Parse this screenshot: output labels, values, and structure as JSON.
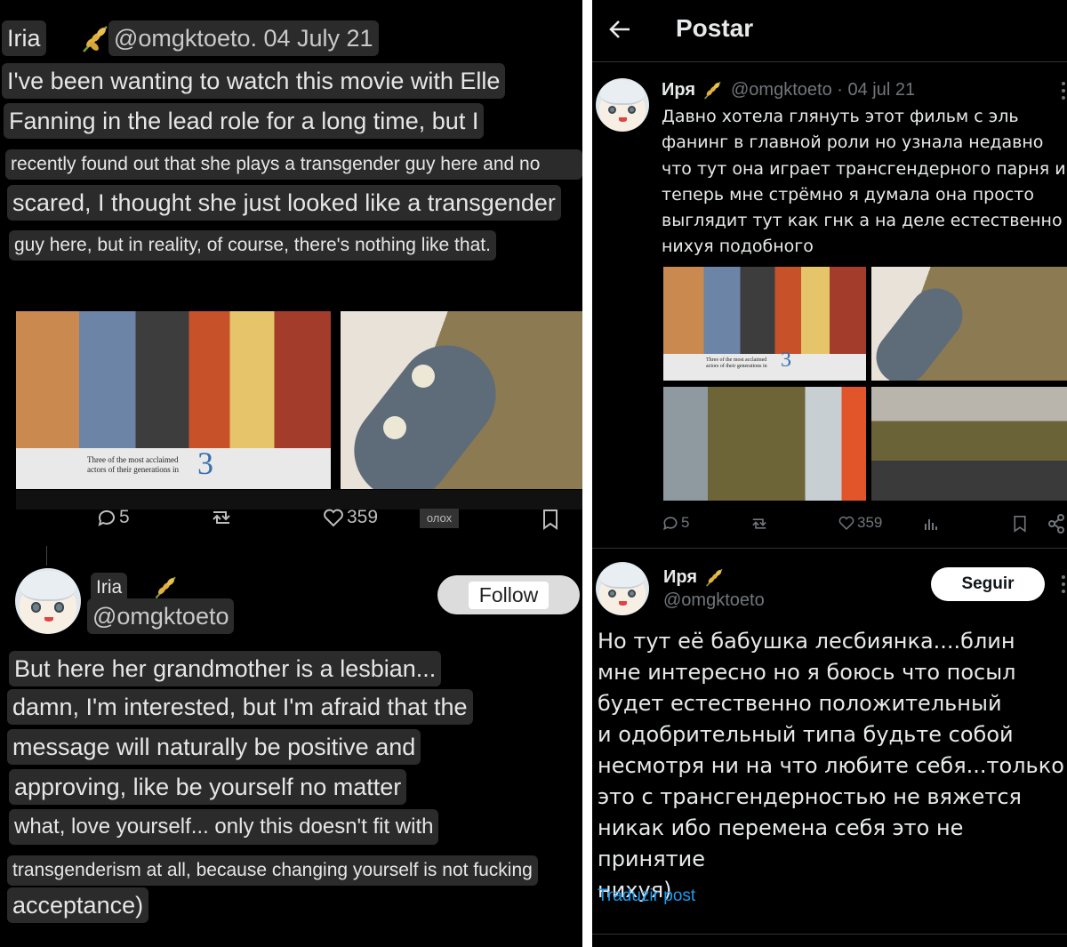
{
  "left": {
    "header": {
      "name": "Iria",
      "handle_date": "@omgktoeto. 04 July 21"
    },
    "tweet_lines": [
      "I've been wanting to watch this movie with Elle",
      "Fanning in the lead role for a long time, but I",
      "recently found out that she plays a transgender guy here and no",
      "scared, I thought she just looked like a transgender",
      "guy here, but in reality, of course, there's nothing like that."
    ],
    "media_caption": "Three of the most acclaimed actors of their generations in",
    "media_caption_number": "3",
    "actions": {
      "replies": "5",
      "likes": "359",
      "views_label": "олох"
    },
    "reply": {
      "name": "Iria",
      "handle": "@omgktoeto",
      "follow_label": "Follow",
      "lines": [
        "But here her grandmother is a lesbian...",
        "damn, I'm interested, but I'm afraid that the",
        "message will naturally be positive and",
        "approving, like be yourself no matter",
        "what, love yourself... only this doesn't fit with",
        "transgenderism at all, because changing yourself is not fucking",
        "acceptance)"
      ]
    }
  },
  "right": {
    "topbar": {
      "title": "Postar"
    },
    "tweet": {
      "name": "Иря",
      "handle_date": "@omgktoeto · 04 jul 21",
      "text_lines": [
        "Давно хотела глянуть этот фильм с эль",
        "фанинг в главной роли но узнала недавно",
        "что тут она играет трансгендерного парня и",
        "теперь мне стрёмно я думала она просто",
        "выглядит тут как гнк а на деле естественно",
        "нихуя подобного"
      ],
      "media_caption": "Three of the most acclaimed actors of their generations in",
      "media_caption_number": "3",
      "actions": {
        "replies": "5",
        "likes": "359"
      }
    },
    "reply": {
      "name": "Иря",
      "handle": "@omgktoeto",
      "follow_label": "Seguir",
      "text_lines": [
        "Но тут её бабушка лесбиянка....блин",
        "мне интересно но я боюсь что посыл",
        "будет естественно положительный",
        "и одобрительный типа будьте собой",
        "несмотря ни на что любите себя...только",
        "это с трансгендерностью не вяжется",
        "никак ибо перемена себя это не принятие",
        "нихуя)"
      ],
      "translate_label": "Traduzir post"
    }
  },
  "colors": {
    "background": "#000000",
    "link_blue": "#1d9bf0",
    "muted_grey": "#71767b",
    "highlight_box": "#2b2b2b"
  },
  "icons": [
    "wheat-emoji-icon",
    "reply-icon",
    "retweet-icon",
    "like-icon",
    "views-icon",
    "bookmark-icon",
    "share-icon",
    "back-arrow-icon",
    "more-icon"
  ]
}
